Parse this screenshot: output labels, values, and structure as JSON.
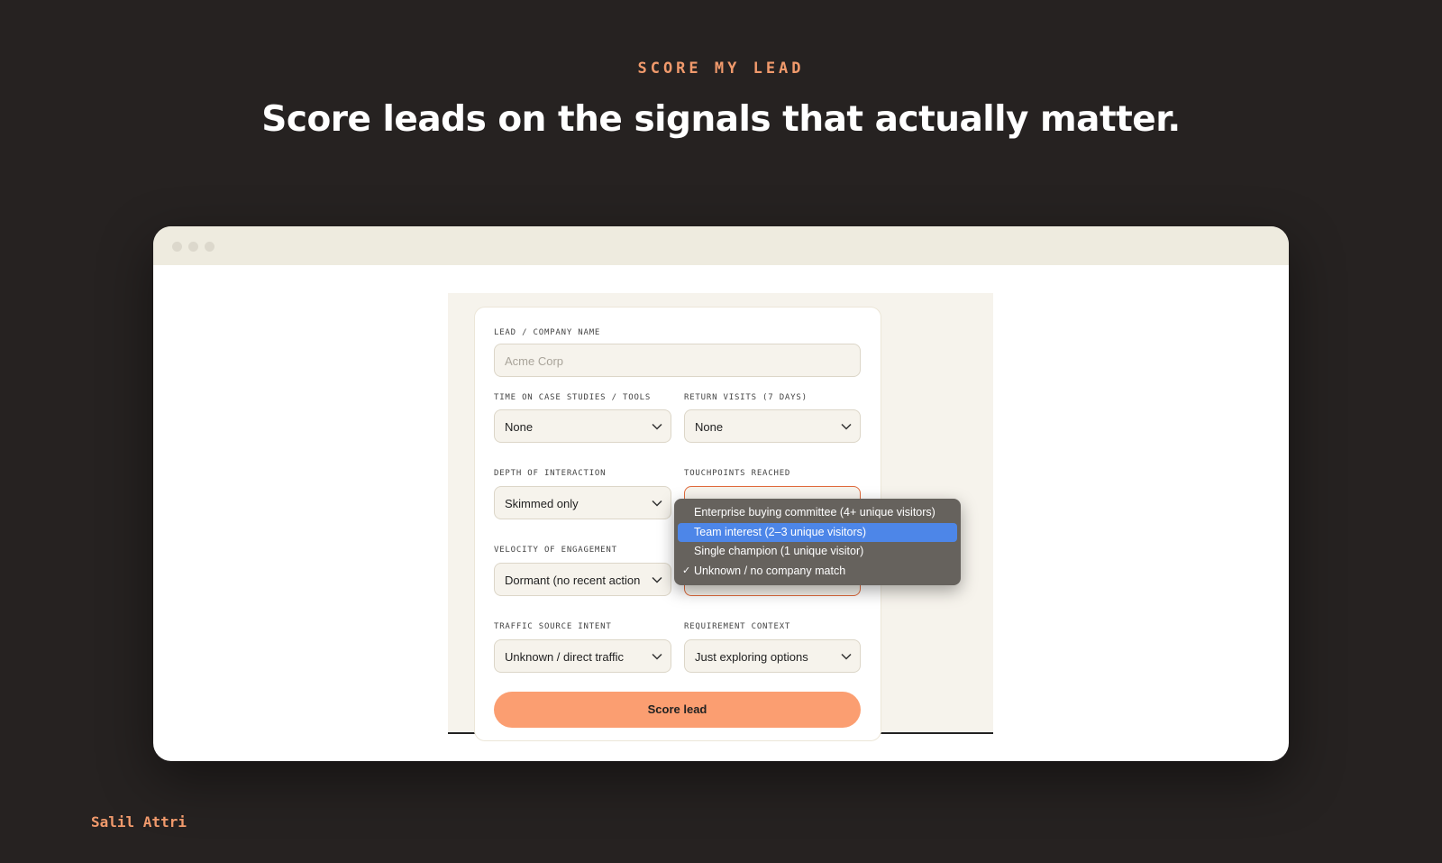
{
  "eyebrow": "SCORE MY LEAD",
  "headline": "Score leads on the signals that actually matter.",
  "author": "Salil Attri",
  "form": {
    "company": {
      "label": "LEAD / COMPANY NAME",
      "placeholder": "Acme Corp",
      "value": ""
    },
    "time_on_case_studies": {
      "label": "TIME ON CASE STUDIES / TOOLS",
      "value": "None"
    },
    "return_visits": {
      "label": "RETURN VISITS (7 DAYS)",
      "value": "None"
    },
    "depth_of_interaction": {
      "label": "DEPTH OF INTERACTION",
      "value": "Skimmed only"
    },
    "touchpoints_reached": {
      "label": "TOUCHPOINTS REACHED",
      "value": "Unknown / no company match"
    },
    "velocity": {
      "label": "VELOCITY OF ENGAGEMENT",
      "value": "Dormant (no recent action"
    },
    "traffic_source": {
      "label": "TRAFFIC SOURCE INTENT",
      "value": "Unknown / direct traffic"
    },
    "requirement_context": {
      "label": "REQUIREMENT CONTEXT",
      "value": "Just exploring options"
    },
    "submit_label": "Score lead"
  },
  "dropdown": {
    "options": [
      {
        "label": "Enterprise buying committee (4+ unique visitors)",
        "highlighted": false,
        "checked": false
      },
      {
        "label": "Team interest (2–3 unique visitors)",
        "highlighted": true,
        "checked": false
      },
      {
        "label": "Single champion (1 unique visitor)",
        "highlighted": false,
        "checked": false
      },
      {
        "label": "Unknown / no company match",
        "highlighted": false,
        "checked": true
      }
    ],
    "check_glyph": "✓"
  },
  "colors": {
    "background": "#262221",
    "accent": "#f19a6c",
    "button": "#fb9e71",
    "highlight": "#4d86e8",
    "focus_border": "#e06a3c"
  },
  "icons": {
    "select_chevron": "chevron-down-icon"
  }
}
